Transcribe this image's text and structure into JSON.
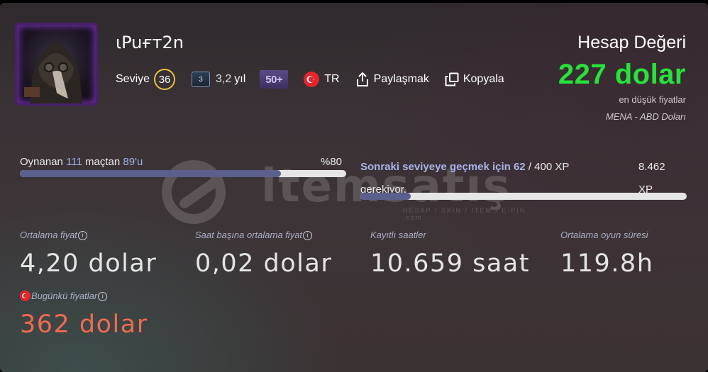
{
  "watermark": {
    "brand": "itemsatış",
    "tagline": "HESAP / SKIN / ITEM / E-PIN .com"
  },
  "profile": {
    "username": "ιPuғт2n",
    "level_label": "Seviye",
    "level": "36",
    "years_badge": "3",
    "years": "3,2",
    "years_unit": "yıl",
    "games_badge": "50+",
    "country": "TR",
    "share_label": "Paylaşmak",
    "copy_label": "Kopyala"
  },
  "account_value": {
    "title": "Hesap Değeri",
    "amount": "227 dolar",
    "note": "en düşük fiyatlar",
    "region": "MENA - ABD Doları"
  },
  "played": {
    "prefix": "Oynanan",
    "played_count": "111",
    "middle": "maçtan",
    "total_count": "89'u",
    "percent": "%80",
    "progress": 0.8
  },
  "next_level": {
    "text_bold": "Sonraki seviyeye geçmek için 62",
    "text_rest": " / 400 XP",
    "text_line2": "gerekiyor.",
    "xp_value": "8.462",
    "xp_unit": "XP",
    "progress": 0.155
  },
  "stats": {
    "avg_price_label": "Ortalama fiyat",
    "avg_price": "4,20 dolar",
    "hourly_label": "Saat başına ortalama fiyat",
    "hourly": "0,02 dolar",
    "hours_label": "Kayıtlı saatler",
    "hours": "10.659 saat",
    "avg_playtime_label": "Ortalama oyun süresi",
    "avg_playtime": "119.8h",
    "today_label": "Bugünkü fiyatlar",
    "today": "362 dolar"
  },
  "colors": {
    "value_green": "#27e23a",
    "today_red": "#ef6a52",
    "accent": "#5a5f8e"
  }
}
